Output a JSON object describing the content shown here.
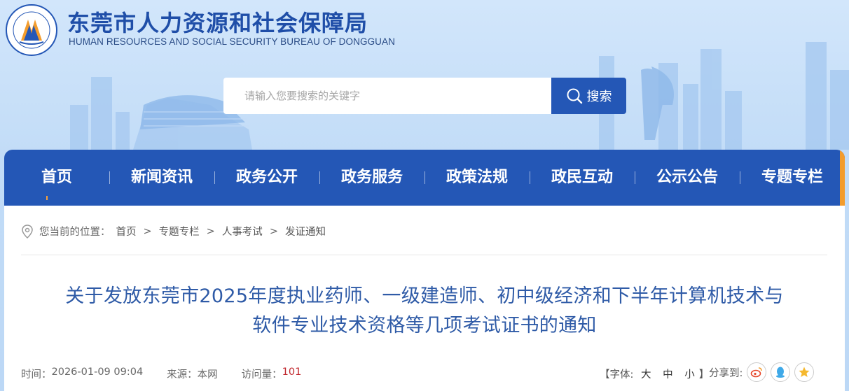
{
  "header": {
    "title_cn": "东莞市人力资源和社会保障局",
    "title_en": "HUMAN RESOURCES AND SOCIAL SECURITY BUREAU OF DONGGUAN",
    "logo_ring_text": "东莞市人力资源和社会保障局"
  },
  "search": {
    "placeholder": "请输入您要搜索的关键字",
    "button_label": "搜索"
  },
  "nav": {
    "items": [
      {
        "label": "首页"
      },
      {
        "label": "新闻资讯"
      },
      {
        "label": "政务公开"
      },
      {
        "label": "政务服务"
      },
      {
        "label": "政策法规"
      },
      {
        "label": "政民互动"
      },
      {
        "label": "公示公告"
      },
      {
        "label": "专题专栏"
      }
    ],
    "active_index": 0
  },
  "breadcrumb": {
    "prefix": "您当前的位置：",
    "items": [
      "首页",
      "专题专栏",
      "人事考试",
      "发证通知"
    ],
    "separator": ">"
  },
  "article": {
    "title_line1": "关于发放东莞市2025年度执业药师、一级建造师、初中级经济和下半年计算机技术与",
    "title_line2": "软件专业技术资格等几项考试证书的通知",
    "time_label": "时间：",
    "time": "2026-01-09 09:04",
    "source_label": "来源：",
    "source": "本网",
    "views_label": "访问量：",
    "views": "101"
  },
  "font_control": {
    "open": "【",
    "label": "字体:",
    "options": [
      "大",
      "中",
      "小"
    ],
    "close": "】"
  },
  "share": {
    "label": "分享到:",
    "targets": [
      "weibo-icon",
      "qq-icon",
      "qzone-icon"
    ]
  },
  "colors": {
    "brand_blue": "#2457b6",
    "title_blue": "#2f5ba7",
    "accent_orange": "#f39c2c",
    "views_red": "#c0272d"
  }
}
